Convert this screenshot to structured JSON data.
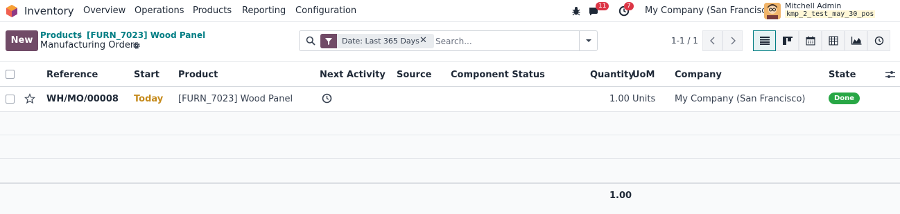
{
  "navbar": {
    "app_name": "Inventory",
    "menu": [
      "Overview",
      "Operations",
      "Products",
      "Reporting",
      "Configuration"
    ],
    "messages_count": "11",
    "activities_count": "7",
    "company": "My Company (San Francisco)",
    "user_name": "Mitchell Admin",
    "database": "kmp_2_test_may_30_pos"
  },
  "control_panel": {
    "new_label": "New",
    "breadcrumb": [
      "Products",
      "[FURN_7023] Wood Panel"
    ],
    "breadcrumb_sep": "/",
    "subtitle": "Manufacturing Orders",
    "search": {
      "facet": "Date: Last 365 Days",
      "placeholder": "Search..."
    },
    "pager": "1-1 / 1"
  },
  "table": {
    "columns": [
      "Reference",
      "Start",
      "Product",
      "Next Activity",
      "Source",
      "Component Status",
      "Quantity",
      "UoM",
      "Company",
      "State"
    ],
    "rows": [
      {
        "reference": "WH/MO/00008",
        "start": "Today",
        "product": "[FURN_7023] Wood Panel",
        "next_activity": "",
        "source": "",
        "component_status": "",
        "quantity": "1.00",
        "uom": "Units",
        "company": "My Company (San Francisco)",
        "state": "Done"
      }
    ],
    "total_quantity": "1.00"
  },
  "colors": {
    "brand": "#714b67",
    "link": "#017e84",
    "today": "#c58a1b",
    "done": "#28a745",
    "badge": "#dc3545"
  },
  "icons": [
    "app-logo-icon",
    "bug-icon",
    "chat-icon",
    "clock-icon",
    "gear-icon",
    "search-icon",
    "filter-icon",
    "close-icon",
    "caret-down-icon",
    "chevron-left-icon",
    "chevron-right-icon",
    "list-view-icon",
    "kanban-view-icon",
    "calendar-view-icon",
    "pivot-view-icon",
    "graph-view-icon",
    "activity-view-icon",
    "star-icon",
    "optional-columns-icon"
  ]
}
